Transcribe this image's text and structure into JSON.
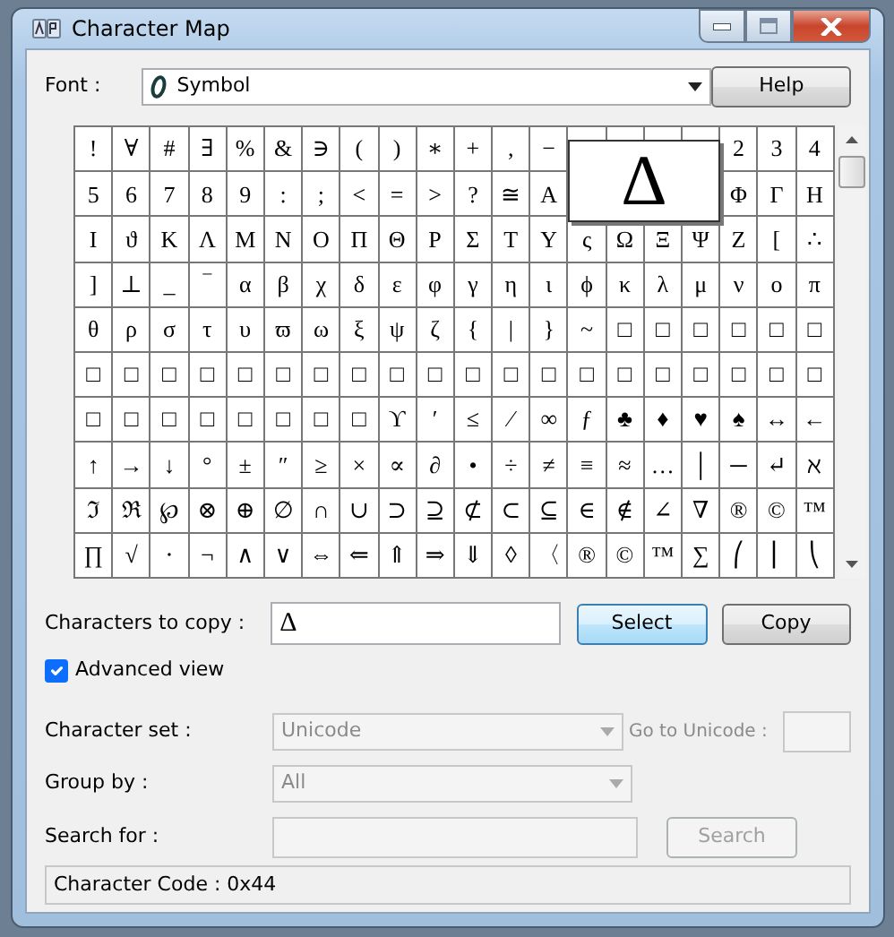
{
  "window": {
    "title": "Character Map"
  },
  "font": {
    "label": "Font :",
    "value": "Symbol"
  },
  "help_button": "Help",
  "grid": {
    "rows": [
      [
        "!",
        "∀",
        "#",
        "∃",
        "%",
        "&",
        "∋",
        "(",
        ")",
        "∗",
        "+",
        ",",
        "−",
        null,
        null,
        null,
        null,
        "2",
        "3",
        "4"
      ],
      [
        "5",
        "6",
        "7",
        "8",
        "9",
        ":",
        ";",
        "<",
        "=",
        ">",
        "?",
        "≅",
        "Α",
        null,
        null,
        null,
        null,
        "Φ",
        "Γ",
        "Η"
      ],
      [
        "Ι",
        "ϑ",
        "Κ",
        "Λ",
        "Μ",
        "Ν",
        "Ο",
        "Π",
        "Θ",
        "Ρ",
        "Σ",
        "Τ",
        "Υ",
        "ς",
        "Ω",
        "Ξ",
        "Ψ",
        "Ζ",
        "[",
        "∴"
      ],
      [
        "]",
        "⊥",
        "_",
        "‾",
        "α",
        "β",
        "χ",
        "δ",
        "ε",
        "φ",
        "γ",
        "η",
        "ι",
        "ϕ",
        "κ",
        "λ",
        "μ",
        "ν",
        "ο",
        "π"
      ],
      [
        "θ",
        "ρ",
        "σ",
        "τ",
        "υ",
        "ϖ",
        "ω",
        "ξ",
        "ψ",
        "ζ",
        "{",
        "|",
        "}",
        "~",
        "□",
        "□",
        "□",
        "□",
        "□",
        "□"
      ],
      [
        "□",
        "□",
        "□",
        "□",
        "□",
        "□",
        "□",
        "□",
        "□",
        "□",
        "□",
        "□",
        "□",
        "□",
        "□",
        "□",
        "□",
        "□",
        "□",
        "□"
      ],
      [
        "□",
        "□",
        "□",
        "□",
        "□",
        "□",
        "□",
        "□",
        "ϒ",
        "′",
        "≤",
        "⁄",
        "∞",
        "ƒ",
        "♣",
        "♦",
        "♥",
        "♠",
        "↔",
        "←"
      ],
      [
        "↑",
        "→",
        "↓",
        "°",
        "±",
        "″",
        "≥",
        "×",
        "∝",
        "∂",
        "•",
        "÷",
        "≠",
        "≡",
        "≈",
        "…",
        "│",
        "─",
        "↵",
        "ℵ"
      ],
      [
        "ℑ",
        "ℜ",
        "℘",
        "⊗",
        "⊕",
        "∅",
        "∩",
        "∪",
        "⊃",
        "⊇",
        "⊄",
        "⊂",
        "⊆",
        "∈",
        "∉",
        "∠",
        "∇",
        "®",
        "©",
        "™"
      ],
      [
        "∏",
        "√",
        "⋅",
        "¬",
        "∧",
        "∨",
        "⇔",
        "⇐",
        "⇑",
        "⇒",
        "⇓",
        "◊",
        "〈",
        "®",
        "©",
        "™",
        "∑",
        "⎛",
        "⎜",
        "⎝"
      ]
    ]
  },
  "enlarged": {
    "char": "Δ"
  },
  "copy": {
    "label": "Characters to copy :",
    "value": "Δ"
  },
  "buttons": [
    {
      "label": "Select",
      "default": true
    },
    {
      "label": "Copy",
      "default": false
    }
  ],
  "advanced_view": {
    "label": "Advanced view",
    "checked": true
  },
  "character_set": {
    "label": "Character set :",
    "value": "Unicode",
    "disabled": true
  },
  "go_to_unicode": {
    "label": "Go to Unicode :",
    "disabled": true
  },
  "group_by": {
    "label": "Group by :",
    "value": "All",
    "disabled": true
  },
  "search": {
    "label": "Search for :",
    "button": "Search",
    "disabled": true
  },
  "status_bar": "Character Code : 0x44"
}
